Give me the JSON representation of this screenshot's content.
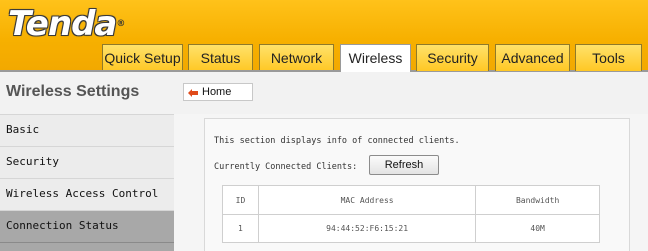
{
  "brand": {
    "logo_text": "Tenda"
  },
  "nav": {
    "tabs": [
      {
        "label": "Quick Setup"
      },
      {
        "label": "Status"
      },
      {
        "label": "Network"
      },
      {
        "label": "Wireless",
        "active": true
      },
      {
        "label": "Security"
      },
      {
        "label": "Advanced"
      },
      {
        "label": "Tools"
      }
    ]
  },
  "sidebar": {
    "title": "Wireless Settings",
    "items": [
      {
        "label": "Basic"
      },
      {
        "label": "Security"
      },
      {
        "label": "Wireless Access Control"
      },
      {
        "label": "Connection Status",
        "active": true
      }
    ]
  },
  "breadcrumb": {
    "home_label": "Home"
  },
  "main": {
    "info_text": "This section displays info of connected clients.",
    "clients_label": "Currently Connected Clients:",
    "refresh_label": "Refresh",
    "table": {
      "headers": [
        "ID",
        "MAC Address",
        "Bandwidth"
      ],
      "rows": [
        [
          "1",
          "94:44:52:F6:15:21",
          "40M"
        ]
      ]
    }
  },
  "colors": {
    "header_gradient_top": "#ffc21a",
    "header_gradient_bottom": "#f2a800",
    "sidebar_active": "#a8a8a8",
    "home_icon": "#e04a1a"
  }
}
